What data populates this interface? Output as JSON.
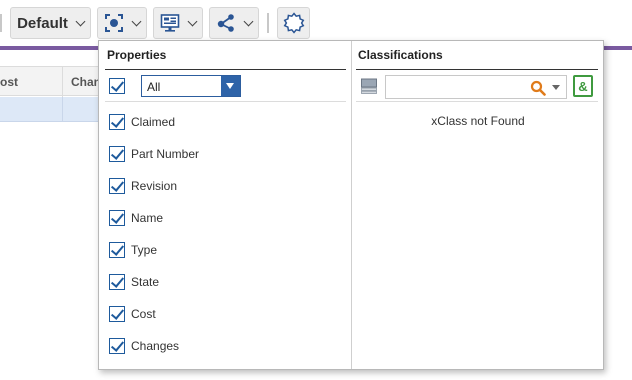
{
  "toolbar": {
    "view_label": "Default",
    "buttons": [
      {
        "icon": "focus-target-icon"
      },
      {
        "icon": "monitor-layout-icon"
      },
      {
        "icon": "share-graph-icon"
      },
      {
        "icon": "settings-gear-icon"
      }
    ]
  },
  "background_table": {
    "columns": [
      "ost",
      "Chan"
    ]
  },
  "properties_panel": {
    "title": "Properties",
    "select_all_value": "All",
    "items": [
      {
        "label": "Claimed",
        "checked": true
      },
      {
        "label": "Part Number",
        "checked": true
      },
      {
        "label": "Revision",
        "checked": true
      },
      {
        "label": "Name",
        "checked": true
      },
      {
        "label": "Type",
        "checked": true
      },
      {
        "label": "State",
        "checked": true
      },
      {
        "label": "Cost",
        "checked": true
      },
      {
        "label": "Changes",
        "checked": true
      }
    ]
  },
  "classifications_panel": {
    "title": "Classifications",
    "search_value": "",
    "and_label": "&",
    "empty_message": "xClass not Found"
  },
  "colors": {
    "accent_blue": "#2e63a8",
    "purple_bar": "#7a5aa0",
    "search_orange": "#e07b1a",
    "and_green": "#3f9a3f"
  }
}
